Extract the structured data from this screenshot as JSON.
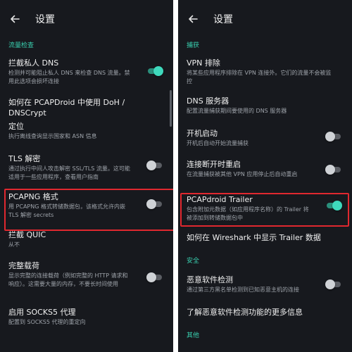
{
  "left": {
    "title": "设置",
    "section_traffic": "流量检查",
    "items": [
      {
        "title": "拦截私人 DNS",
        "summary": "检测并可能阻止私人 DNS 来检查 DNS 流量。禁用此选项会损坏连接"
      },
      {
        "title": "如何在 PCAPDroid 中使用 DoH / DNSCrypt"
      },
      {
        "title": "定位",
        "summary": "执行离线查询显示国家和 ASN 信息"
      },
      {
        "title": "TLS 解密",
        "summary": "通过执行中间人攻击解密 SSL/TLS 流量。这可能适用于一些应用程序，查看用户指南"
      },
      {
        "title": "PCAPNG 格式",
        "summary": "用 PCAPNG 格式转储数据包，该格式允许内嵌 TLS 解密 secrets"
      },
      {
        "title": "拦截 QUIC",
        "summary": "从不"
      },
      {
        "title": "完整载荷",
        "summary": "显示完整的连接载荷（例如完整的 HTTP 请求和响应）。这需要大量的内存，不要长时间使用"
      },
      {
        "title": "启用 SOCKS5 代理",
        "summary": "配置到 SOCKS5 代理的重定向"
      }
    ]
  },
  "right": {
    "title": "设置",
    "section_capture": "捕获",
    "section_security": "安全",
    "section_other": "其他",
    "items": [
      {
        "title": "VPN 排除",
        "summary": "将某些应用程序排除在 VPN 连接外。它们的流量不会被监控"
      },
      {
        "title": "DNS 服务器",
        "summary": "配置流量捕获期间要使用的 DNS 服务器"
      },
      {
        "title": "开机启动",
        "summary": "开机后自动开始流量捕获"
      },
      {
        "title": "连接断开时重启",
        "summary": "在流量捕获被其他 VPN 应用停止后自动重启"
      },
      {
        "title": "PCAPdroid Trailer",
        "summary": "包含附加元数据（如应用程序名称）的 Trailer 将被添加到转储数据包中"
      },
      {
        "title": "如何在 Wireshark 中显示 Trailer 数据"
      },
      {
        "title": "恶意软件检测",
        "summary": "通过第三方黑名单检测到已知恶意主机的连接"
      },
      {
        "title": "了解恶意软件检测功能的更多信息"
      }
    ]
  },
  "switches": {
    "block_private_dns": true,
    "tls_decryption": false,
    "pcapng_format": false,
    "full_payload": false,
    "auto_start": false,
    "restart_on_disconnect": false,
    "pcapdroid_trailer": true,
    "malware_detection": false
  },
  "colors": {
    "background": "#17191e",
    "accent": "#3fd9bd",
    "highlight": "#e0282f"
  }
}
